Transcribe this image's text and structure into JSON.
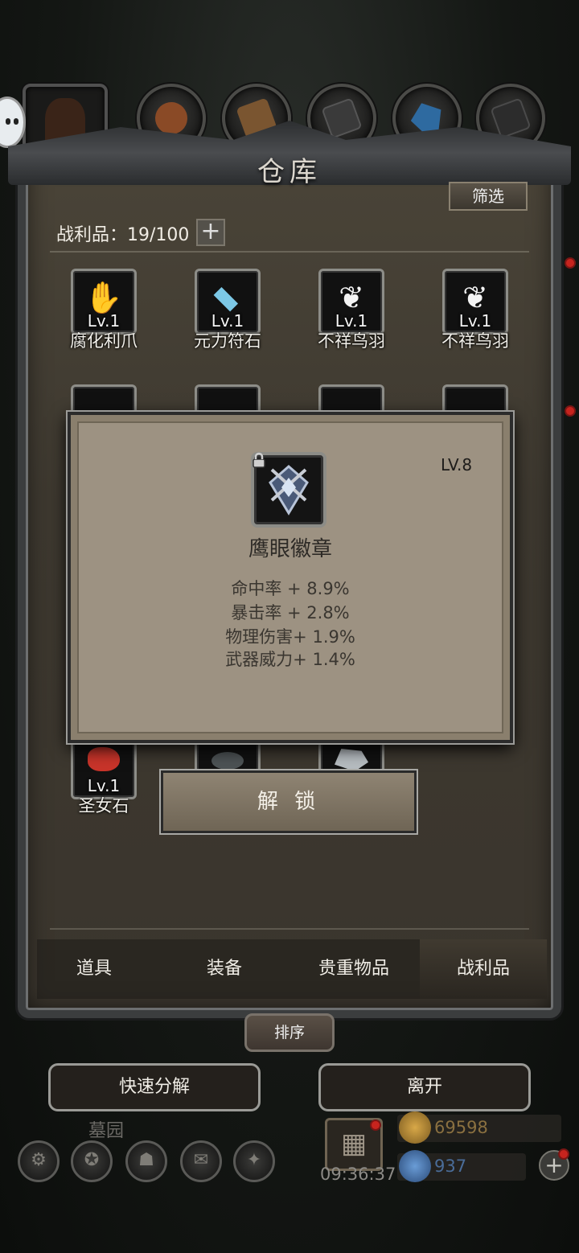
{
  "window": {
    "title": "仓库"
  },
  "toolbar": {
    "filter_label": "筛选"
  },
  "inventory": {
    "count_label": "战利品：19/100",
    "plus_label": "+"
  },
  "items_row1": [
    {
      "level": "Lv.1",
      "name": "腐化利爪",
      "icon": "claw-icon"
    },
    {
      "level": "Lv.1",
      "name": "元力符石",
      "icon": "rune-stone-icon"
    },
    {
      "level": "Lv.1",
      "name": "不祥鸟羽",
      "icon": "feather-icon"
    },
    {
      "level": "Lv.1",
      "name": "不祥鸟羽",
      "icon": "feather-icon"
    }
  ],
  "items_bottom": [
    {
      "level": "Lv.1",
      "name": "圣女石",
      "icon": "red-gem-icon"
    }
  ],
  "popup": {
    "level": "LV.8",
    "title": "鹰眼徽章",
    "stats": [
      "命中率 + 8.9%",
      "暴击率 + 2.8%",
      "物理伤害+ 1.9%",
      "武器威力+ 1.4%"
    ],
    "unlock_label": "解 锁",
    "icon": "eagle-eye-badge-icon"
  },
  "tabs": [
    "道具",
    "装备",
    "贵重物品",
    "战利品"
  ],
  "sort_label": "排序",
  "actions": {
    "quick_decompose": "快速分解",
    "leave": "离开"
  },
  "hud": {
    "location": "墓园",
    "time": "09:36:37",
    "gold": "69598",
    "gems": "937"
  },
  "colors": {
    "panel": "#3e3930",
    "popup": "#9d9282",
    "frame": "#3b3d3e"
  }
}
